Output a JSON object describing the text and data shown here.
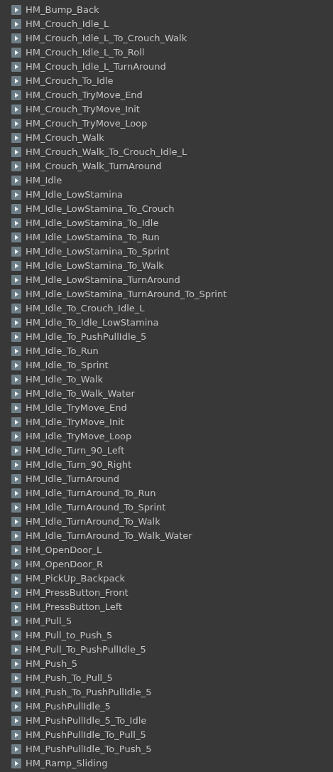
{
  "clips": [
    "HM_Bump_Back",
    "HM_Crouch_Idle_L",
    "HM_Crouch_Idle_L_To_Crouch_Walk",
    "HM_Crouch_Idle_L_To_Roll",
    "HM_Crouch_Idle_L_TurnAround",
    "HM_Crouch_To_Idle",
    "HM_Crouch_TryMove_End",
    "HM_Crouch_TryMove_Init",
    "HM_Crouch_TryMove_Loop",
    "HM_Crouch_Walk",
    "HM_Crouch_Walk_To_Crouch_Idle_L",
    "HM_Crouch_Walk_TurnAround",
    "HM_Idle",
    "HM_Idle_LowStamina",
    "HM_Idle_LowStamina_To_Crouch",
    "HM_Idle_LowStamina_To_Idle",
    "HM_Idle_LowStamina_To_Run",
    "HM_Idle_LowStamina_To_Sprint",
    "HM_Idle_LowStamina_To_Walk",
    "HM_Idle_LowStamina_TurnAround",
    "HM_Idle_LowStamina_TurnAround_To_Sprint",
    "HM_Idle_To_Crouch_Idle_L",
    "HM_Idle_To_Idle_LowStamina",
    "HM_Idle_To_PushPullIdle_5",
    "HM_Idle_To_Run",
    "HM_Idle_To_Sprint",
    "HM_Idle_To_Walk",
    "HM_Idle_To_Walk_Water",
    "HM_Idle_TryMove_End",
    "HM_Idle_TryMove_Init",
    "HM_Idle_TryMove_Loop",
    "HM_Idle_Turn_90_Left",
    "HM_Idle_Turn_90_Right",
    "HM_Idle_TurnAround",
    "HM_Idle_TurnAround_To_Run",
    "HM_Idle_TurnAround_To_Sprint",
    "HM_Idle_TurnAround_To_Walk",
    "HM_Idle_TurnAround_To_Walk_Water",
    "HM_OpenDoor_L",
    "HM_OpenDoor_R",
    "HM_PickUp_Backpack",
    "HM_PressButton_Front",
    "HM_PressButton_Left",
    "HM_Pull_5",
    "HM_Pull_to_Push_5",
    "HM_Pull_To_PushPullIdle_5",
    "HM_Push_5",
    "HM_Push_To_Pull_5",
    "HM_Push_To_PushPullIdle_5",
    "HM_PushPullIdle_5",
    "HM_PushPullIdle_5_To_Idle",
    "HM_PushPullIdle_To_Pull_5",
    "HM_PushPullIdle_To_Push_5",
    "HM_Ramp_Sliding"
  ]
}
